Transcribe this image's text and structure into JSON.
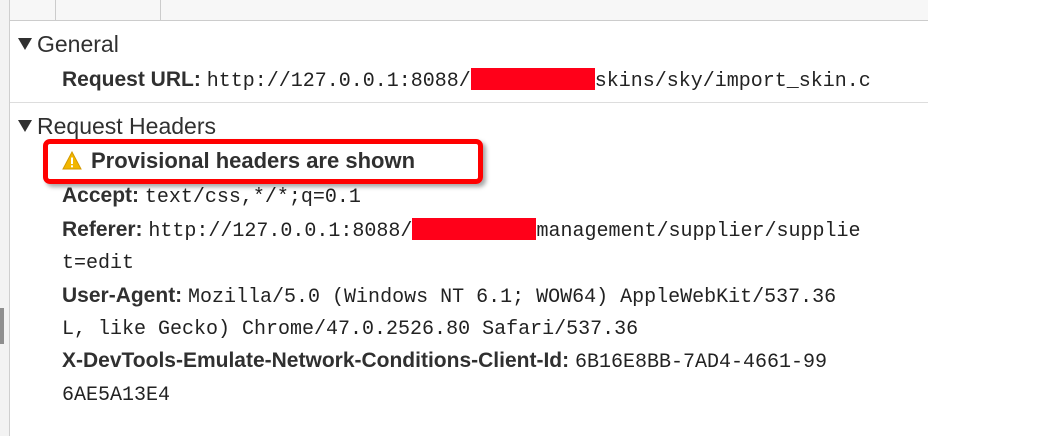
{
  "general": {
    "title": "General",
    "request_url": {
      "key": "Request URL:",
      "value_before": "http://127.0.0.1:8088/",
      "value_after": "skins/sky/import_skin.c"
    }
  },
  "request_headers": {
    "title": "Request Headers",
    "warning": "Provisional headers are shown",
    "accept": {
      "key": "Accept:",
      "value": "text/css,*/*;q=0.1"
    },
    "referer": {
      "key": "Referer:",
      "value_before": "http://127.0.0.1:8088/",
      "value_after": "management/supplier/supplie",
      "value_cont": "t=edit"
    },
    "user_agent": {
      "key": "User-Agent:",
      "value": "Mozilla/5.0 (Windows NT 6.1; WOW64) AppleWebKit/537.36",
      "value_cont": "L, like Gecko) Chrome/47.0.2526.80 Safari/537.36"
    },
    "client_id": {
      "key": "X-DevTools-Emulate-Network-Conditions-Client-Id:",
      "value": "6B16E8BB-7AD4-4661-99",
      "value_cont": "6AE5A13E4"
    }
  },
  "colors": {
    "redaction": "#ff0019",
    "callout_border": "#ff0000",
    "warning_icon": "#f2b600"
  }
}
